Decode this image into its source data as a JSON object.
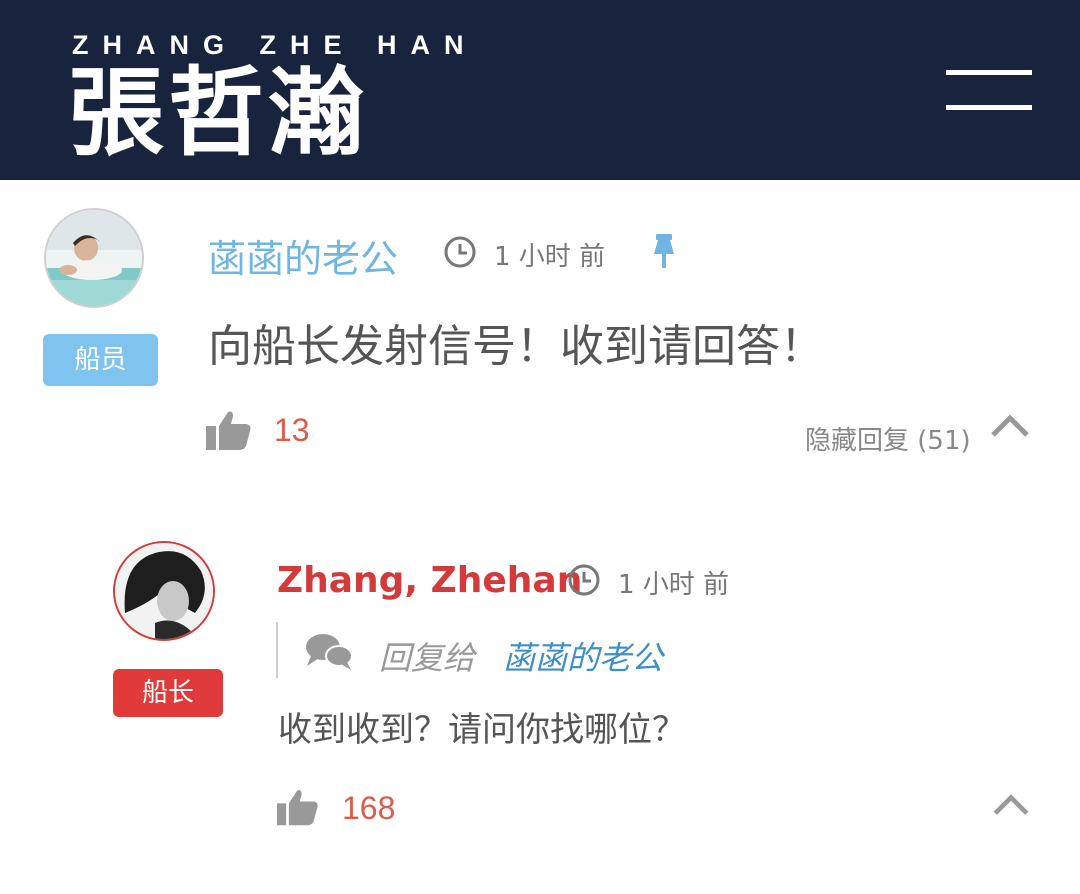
{
  "header": {
    "brand_sub": "ZHANG ZHE HAN",
    "brand_main": "張哲瀚",
    "background": "#18233d"
  },
  "comment": {
    "author": "菡菡的老公",
    "author_color": "#6fb6e3",
    "badge": "船员",
    "badge_color": "#7ec4ee",
    "time": "1 小时 前",
    "text": "向船长发射信号！收到请回答！",
    "likes": "13",
    "hide_replies": "隐藏回复",
    "replies_count": "(51)"
  },
  "reply": {
    "author": "Zhang, Zhehan",
    "author_color": "#d33b3b",
    "badge": "船长",
    "badge_color": "#e03a3a",
    "time": "1 小时 前",
    "reply_to_label": "回复给",
    "reply_to_name": "菡菡的老公",
    "text": "收到收到？请问你找哪位？",
    "likes": "168"
  }
}
